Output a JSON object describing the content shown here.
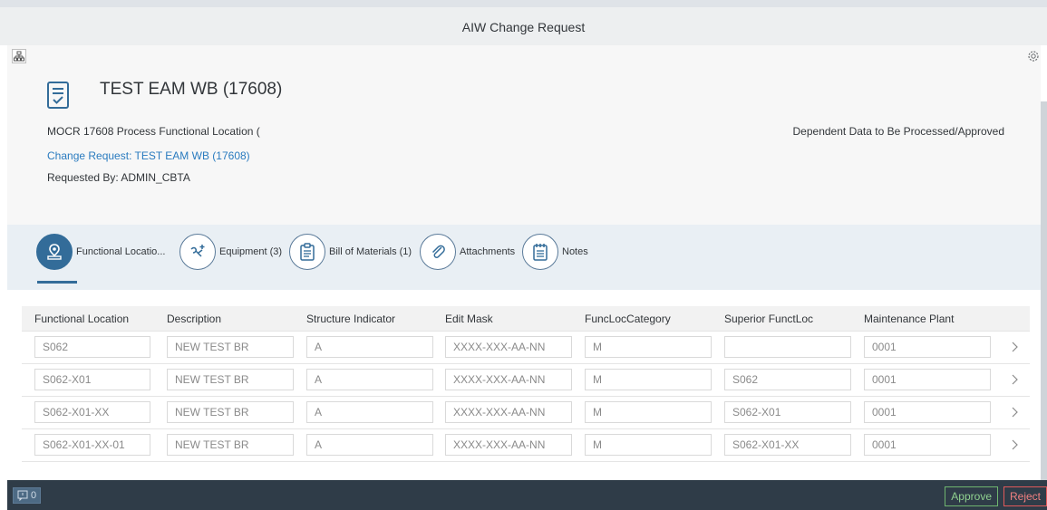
{
  "shell": {
    "title": "AIW Change Request"
  },
  "object": {
    "title": "TEST EAM WB (17608)",
    "description": "MOCR 17608 Process Functional Location (",
    "change_request_link": "Change Request: TEST EAM WB (17608)",
    "requested_by": "Requested By: ADMIN_CBTA",
    "status": "Dependent Data to Be Processed/Approved"
  },
  "tabs": [
    {
      "label": "Functional Locatio...",
      "icon": "functional-location-icon",
      "selected": true
    },
    {
      "label": "Equipment (3)",
      "icon": "equipment-icon",
      "selected": false
    },
    {
      "label": "Bill of Materials (1)",
      "icon": "clipboard-icon",
      "selected": false
    },
    {
      "label": "Attachments",
      "icon": "paperclip-icon",
      "selected": false
    },
    {
      "label": "Notes",
      "icon": "notes-icon",
      "selected": false
    }
  ],
  "table": {
    "columns": [
      "Functional Location",
      "Description",
      "Structure Indicator",
      "Edit Mask",
      "FuncLocCategory",
      "Superior FunctLoc",
      "Maintenance Plant"
    ],
    "rows": [
      [
        "S062",
        "NEW TEST BR",
        "A",
        "XXXX-XXX-AA-NN",
        "M",
        "",
        "0001"
      ],
      [
        "S062-X01",
        "NEW TEST BR",
        "A",
        "XXXX-XXX-AA-NN",
        "M",
        "S062",
        "0001"
      ],
      [
        "S062-X01-XX",
        "NEW TEST BR",
        "A",
        "XXXX-XXX-AA-NN",
        "M",
        "S062-X01",
        "0001"
      ],
      [
        "S062-X01-XX-01",
        "NEW TEST BR",
        "A",
        "XXXX-XXX-AA-NN",
        "M",
        "S062-X01-XX",
        "0001"
      ]
    ]
  },
  "footer": {
    "message_count": "0",
    "approve_label": "Approve",
    "reject_label": "Reject"
  },
  "colors": {
    "accent": "#336c99",
    "link": "#2a7bbf",
    "footer_bg": "#2f3c48",
    "approve": "#6fb56f",
    "reject": "#e05a5a"
  }
}
